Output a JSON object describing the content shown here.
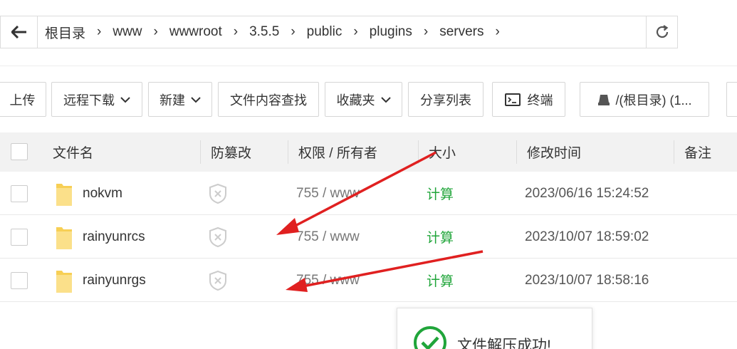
{
  "breadcrumb": [
    "根目录",
    "www",
    "wwwroot",
    "3.5.5",
    "public",
    "plugins",
    "servers"
  ],
  "toolbar": {
    "upload": "上传",
    "remote_download": "远程下载",
    "new": "新建",
    "content_search": "文件内容查找",
    "favorites": "收藏夹",
    "share_list": "分享列表",
    "terminal": "终端",
    "disk": "/(根目录) (1..."
  },
  "table": {
    "headers": {
      "name": "文件名",
      "tamper": "防篡改",
      "perm": "权限 / 所有者",
      "size": "大小",
      "mtime": "修改时间",
      "note": "备注"
    },
    "rows": [
      {
        "name": "nokvm",
        "perm": "755 / www",
        "size": "计算",
        "mtime": "2023/06/16 15:24:52"
      },
      {
        "name": "rainyunrcs",
        "perm": "755 / www",
        "size": "计算",
        "mtime": "2023/10/07 18:59:02"
      },
      {
        "name": "rainyunrgs",
        "perm": "755 / www",
        "size": "计算",
        "mtime": "2023/10/07 18:58:16"
      }
    ]
  },
  "toast": {
    "message": "文件解压成功!"
  },
  "colors": {
    "accent_green": "#20a53a",
    "folder_yellow": "#f7cf55",
    "annotation_red": "#e02020"
  },
  "icons": {
    "back": "back-arrow-icon",
    "refresh": "refresh-icon",
    "folder": "folder-icon",
    "shield": "shield-icon",
    "terminal": "terminal-icon",
    "disk": "disk-icon",
    "success": "check-circle-icon"
  }
}
